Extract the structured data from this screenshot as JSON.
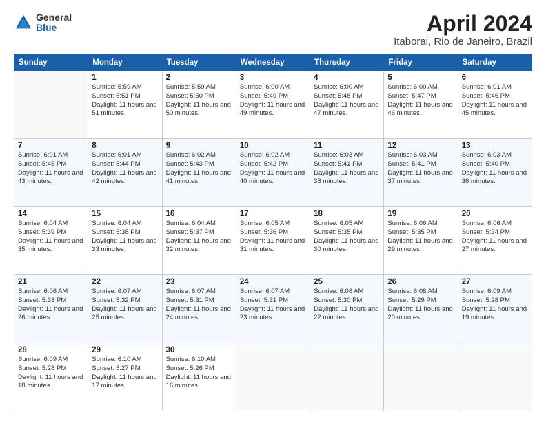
{
  "logo": {
    "general": "General",
    "blue": "Blue"
  },
  "title": {
    "month": "April 2024",
    "location": "Itaborai, Rio de Janeiro, Brazil"
  },
  "days_of_week": [
    "Sunday",
    "Monday",
    "Tuesday",
    "Wednesday",
    "Thursday",
    "Friday",
    "Saturday"
  ],
  "weeks": [
    [
      {
        "day": "",
        "sunrise": "",
        "sunset": "",
        "daylight": ""
      },
      {
        "day": "1",
        "sunrise": "Sunrise: 5:59 AM",
        "sunset": "Sunset: 5:51 PM",
        "daylight": "Daylight: 11 hours and 51 minutes."
      },
      {
        "day": "2",
        "sunrise": "Sunrise: 5:59 AM",
        "sunset": "Sunset: 5:50 PM",
        "daylight": "Daylight: 11 hours and 50 minutes."
      },
      {
        "day": "3",
        "sunrise": "Sunrise: 6:00 AM",
        "sunset": "Sunset: 5:49 PM",
        "daylight": "Daylight: 11 hours and 49 minutes."
      },
      {
        "day": "4",
        "sunrise": "Sunrise: 6:00 AM",
        "sunset": "Sunset: 5:48 PM",
        "daylight": "Daylight: 11 hours and 47 minutes."
      },
      {
        "day": "5",
        "sunrise": "Sunrise: 6:00 AM",
        "sunset": "Sunset: 5:47 PM",
        "daylight": "Daylight: 11 hours and 46 minutes."
      },
      {
        "day": "6",
        "sunrise": "Sunrise: 6:01 AM",
        "sunset": "Sunset: 5:46 PM",
        "daylight": "Daylight: 11 hours and 45 minutes."
      }
    ],
    [
      {
        "day": "7",
        "sunrise": "Sunrise: 6:01 AM",
        "sunset": "Sunset: 5:45 PM",
        "daylight": "Daylight: 11 hours and 43 minutes."
      },
      {
        "day": "8",
        "sunrise": "Sunrise: 6:01 AM",
        "sunset": "Sunset: 5:44 PM",
        "daylight": "Daylight: 11 hours and 42 minutes."
      },
      {
        "day": "9",
        "sunrise": "Sunrise: 6:02 AM",
        "sunset": "Sunset: 5:43 PM",
        "daylight": "Daylight: 11 hours and 41 minutes."
      },
      {
        "day": "10",
        "sunrise": "Sunrise: 6:02 AM",
        "sunset": "Sunset: 5:42 PM",
        "daylight": "Daylight: 11 hours and 40 minutes."
      },
      {
        "day": "11",
        "sunrise": "Sunrise: 6:03 AM",
        "sunset": "Sunset: 5:41 PM",
        "daylight": "Daylight: 11 hours and 38 minutes."
      },
      {
        "day": "12",
        "sunrise": "Sunrise: 6:03 AM",
        "sunset": "Sunset: 5:41 PM",
        "daylight": "Daylight: 11 hours and 37 minutes."
      },
      {
        "day": "13",
        "sunrise": "Sunrise: 6:03 AM",
        "sunset": "Sunset: 5:40 PM",
        "daylight": "Daylight: 11 hours and 36 minutes."
      }
    ],
    [
      {
        "day": "14",
        "sunrise": "Sunrise: 6:04 AM",
        "sunset": "Sunset: 5:39 PM",
        "daylight": "Daylight: 11 hours and 35 minutes."
      },
      {
        "day": "15",
        "sunrise": "Sunrise: 6:04 AM",
        "sunset": "Sunset: 5:38 PM",
        "daylight": "Daylight: 11 hours and 33 minutes."
      },
      {
        "day": "16",
        "sunrise": "Sunrise: 6:04 AM",
        "sunset": "Sunset: 5:37 PM",
        "daylight": "Daylight: 11 hours and 32 minutes."
      },
      {
        "day": "17",
        "sunrise": "Sunrise: 6:05 AM",
        "sunset": "Sunset: 5:36 PM",
        "daylight": "Daylight: 11 hours and 31 minutes."
      },
      {
        "day": "18",
        "sunrise": "Sunrise: 6:05 AM",
        "sunset": "Sunset: 5:35 PM",
        "daylight": "Daylight: 11 hours and 30 minutes."
      },
      {
        "day": "19",
        "sunrise": "Sunrise: 6:06 AM",
        "sunset": "Sunset: 5:35 PM",
        "daylight": "Daylight: 11 hours and 29 minutes."
      },
      {
        "day": "20",
        "sunrise": "Sunrise: 6:06 AM",
        "sunset": "Sunset: 5:34 PM",
        "daylight": "Daylight: 11 hours and 27 minutes."
      }
    ],
    [
      {
        "day": "21",
        "sunrise": "Sunrise: 6:06 AM",
        "sunset": "Sunset: 5:33 PM",
        "daylight": "Daylight: 11 hours and 26 minutes."
      },
      {
        "day": "22",
        "sunrise": "Sunrise: 6:07 AM",
        "sunset": "Sunset: 5:32 PM",
        "daylight": "Daylight: 11 hours and 25 minutes."
      },
      {
        "day": "23",
        "sunrise": "Sunrise: 6:07 AM",
        "sunset": "Sunset: 5:31 PM",
        "daylight": "Daylight: 11 hours and 24 minutes."
      },
      {
        "day": "24",
        "sunrise": "Sunrise: 6:07 AM",
        "sunset": "Sunset: 5:31 PM",
        "daylight": "Daylight: 11 hours and 23 minutes."
      },
      {
        "day": "25",
        "sunrise": "Sunrise: 6:08 AM",
        "sunset": "Sunset: 5:30 PM",
        "daylight": "Daylight: 11 hours and 22 minutes."
      },
      {
        "day": "26",
        "sunrise": "Sunrise: 6:08 AM",
        "sunset": "Sunset: 5:29 PM",
        "daylight": "Daylight: 11 hours and 20 minutes."
      },
      {
        "day": "27",
        "sunrise": "Sunrise: 6:09 AM",
        "sunset": "Sunset: 5:28 PM",
        "daylight": "Daylight: 11 hours and 19 minutes."
      }
    ],
    [
      {
        "day": "28",
        "sunrise": "Sunrise: 6:09 AM",
        "sunset": "Sunset: 5:28 PM",
        "daylight": "Daylight: 11 hours and 18 minutes."
      },
      {
        "day": "29",
        "sunrise": "Sunrise: 6:10 AM",
        "sunset": "Sunset: 5:27 PM",
        "daylight": "Daylight: 11 hours and 17 minutes."
      },
      {
        "day": "30",
        "sunrise": "Sunrise: 6:10 AM",
        "sunset": "Sunset: 5:26 PM",
        "daylight": "Daylight: 11 hours and 16 minutes."
      },
      {
        "day": "",
        "sunrise": "",
        "sunset": "",
        "daylight": ""
      },
      {
        "day": "",
        "sunrise": "",
        "sunset": "",
        "daylight": ""
      },
      {
        "day": "",
        "sunrise": "",
        "sunset": "",
        "daylight": ""
      },
      {
        "day": "",
        "sunrise": "",
        "sunset": "",
        "daylight": ""
      }
    ]
  ]
}
